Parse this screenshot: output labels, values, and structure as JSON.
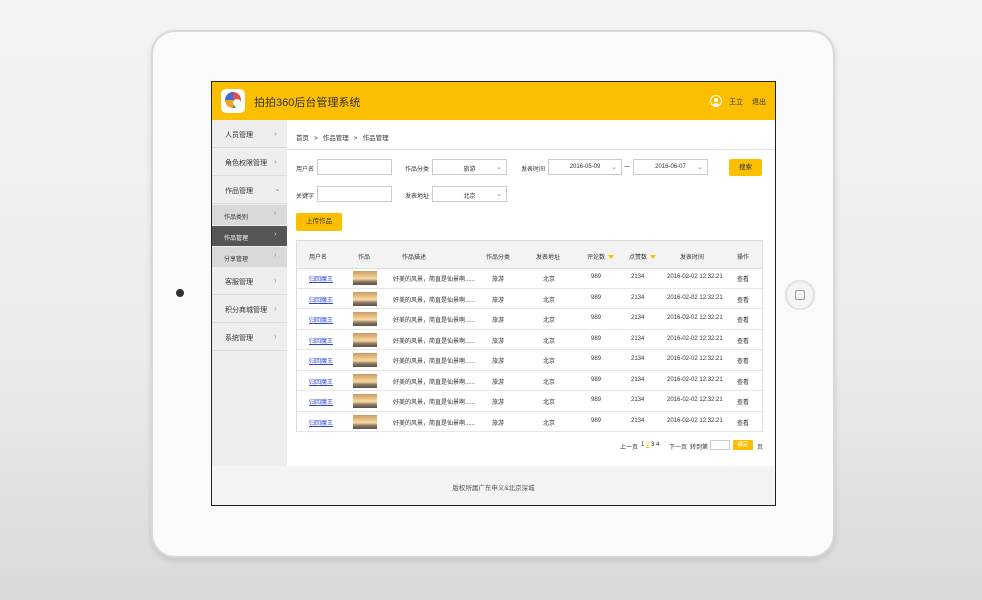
{
  "header": {
    "title": "拍拍360后台管理系统",
    "user": "王立",
    "logout": "退出"
  },
  "colors": {
    "accent": "#fbbf00",
    "active_nav": "#555555",
    "link": "#2b45d6"
  },
  "sidebar": {
    "items": [
      {
        "label": "人员管理"
      },
      {
        "label": "角色权限管理"
      },
      {
        "label": "作品管理"
      },
      {
        "label": "客服管理"
      },
      {
        "label": "积分商城管理"
      },
      {
        "label": "系统管理"
      }
    ],
    "subitems": [
      {
        "label": "作品类别"
      },
      {
        "label": "作品管理"
      },
      {
        "label": "分享管理"
      }
    ]
  },
  "breadcrumb": [
    "首页",
    "作品管理",
    "作品管理"
  ],
  "breadcrumb_sep": ">",
  "filters": {
    "username_label": "用户名",
    "category_label": "作品分类",
    "category_value": "旅游",
    "date_label": "发表时间",
    "date_start": "2016-05-09",
    "date_sep": "—",
    "date_end": "2016-06-07",
    "search_button": "搜索",
    "keyword_label": "关键字",
    "location_label": "发表地址",
    "location_value": "北京"
  },
  "upload_button": "上传作品",
  "table": {
    "columns": [
      "用户名",
      "作品",
      "作品描述",
      "作品分类",
      "发表地址",
      "评论数",
      "点赞数",
      "发表时间",
      "操作"
    ],
    "rows": [
      {
        "user": "归回魔王",
        "desc": "好美的风景，简直是仙景啊......",
        "category": "旅游",
        "location": "北京",
        "comments": "989",
        "likes": "2134",
        "time": "2016-02-02  12:32:21",
        "action": "查看"
      },
      {
        "user": "归回魔王",
        "desc": "好美的风景，简直是仙景啊......",
        "category": "旅游",
        "location": "北京",
        "comments": "989",
        "likes": "2134",
        "time": "2016-02-02  12:32:21",
        "action": "查看"
      },
      {
        "user": "归回魔王",
        "desc": "好美的风景，简直是仙景啊......",
        "category": "旅游",
        "location": "北京",
        "comments": "989",
        "likes": "2134",
        "time": "2016-02-02  12:32:21",
        "action": "查看"
      },
      {
        "user": "归回魔王",
        "desc": "好美的风景，简直是仙景啊......",
        "category": "旅游",
        "location": "北京",
        "comments": "989",
        "likes": "2134",
        "time": "2016-02-02  12:32:21",
        "action": "查看"
      },
      {
        "user": "归回魔王",
        "desc": "好美的风景，简直是仙景啊......",
        "category": "旅游",
        "location": "北京",
        "comments": "989",
        "likes": "2134",
        "time": "2016-02-02  12:32:21",
        "action": "查看"
      },
      {
        "user": "归回魔王",
        "desc": "好美的风景，简直是仙景啊......",
        "category": "旅游",
        "location": "北京",
        "comments": "989",
        "likes": "2134",
        "time": "2016-02-02  12:32:21",
        "action": "查看"
      },
      {
        "user": "归回魔王",
        "desc": "好美的风景，简直是仙景啊......",
        "category": "旅游",
        "location": "北京",
        "comments": "989",
        "likes": "2134",
        "time": "2016-02-02  12:32:21",
        "action": "查看"
      },
      {
        "user": "归回魔王",
        "desc": "好美的风景，简直是仙景啊......",
        "category": "旅游",
        "location": "北京",
        "comments": "989",
        "likes": "2134",
        "time": "2016-02-02  12:32:21",
        "action": "查看"
      }
    ]
  },
  "pagination": {
    "prev": "上一页",
    "pages": [
      "1",
      "2",
      "3",
      "4"
    ],
    "current": "2",
    "next": "下一页",
    "goto_label": "转到第",
    "confirm": "确定",
    "page_suffix": "页"
  },
  "footer": {
    "copyright": "版权所属广东申义&北京深城"
  }
}
